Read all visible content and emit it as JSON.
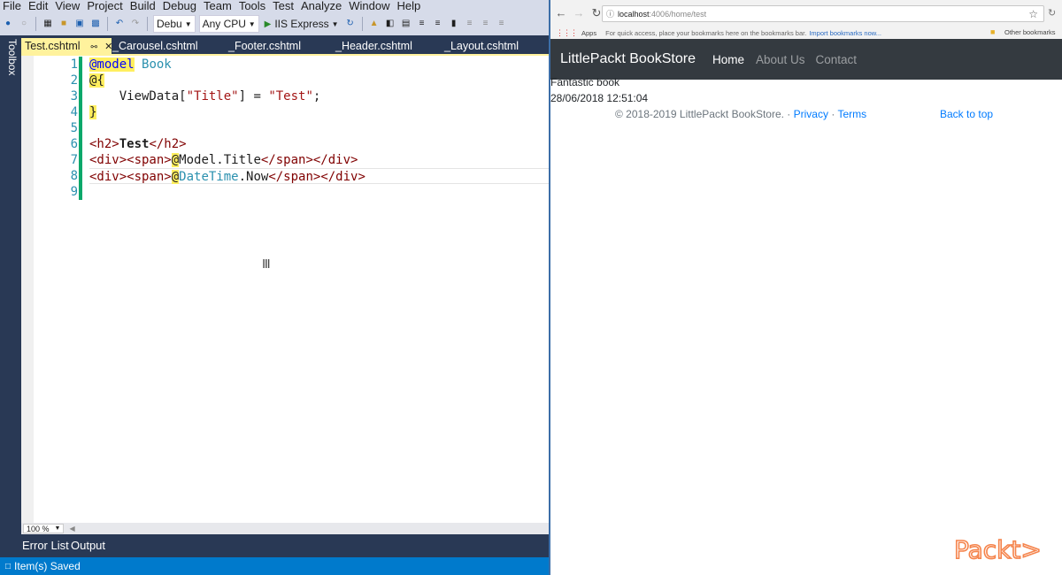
{
  "vs": {
    "menu": [
      "File",
      "Edit",
      "View",
      "Project",
      "Build",
      "Debug",
      "Team",
      "Tools",
      "Test",
      "Analyze",
      "Window",
      "Help"
    ],
    "toolbar": {
      "config": "Debu",
      "platform": "Any CPU",
      "run_target": "IIS Express"
    },
    "toolbox_label": "Toolbox",
    "tabs": [
      "Test.cshtml",
      "_Carousel.cshtml",
      "_Footer.cshtml",
      "_Header.cshtml",
      "_Layout.cshtml"
    ],
    "active_tab": "Test.cshtml",
    "line_numbers": [
      "1",
      "2",
      "3",
      "4",
      "5",
      "6",
      "7",
      "8",
      "9"
    ],
    "code": {
      "l1": {
        "directive": "@model",
        "type": "Book"
      },
      "l2": {
        "open": "@{"
      },
      "l3": {
        "ident": "ViewData",
        "lb": "[",
        "key": "\"Title\"",
        "rest": "] = ",
        "value": "\"Test\"",
        "end": ";"
      },
      "l4": {
        "close": "}"
      },
      "l6": {
        "open_tag": "<h2>",
        "text": "Test",
        "close_tag": "</h2>"
      },
      "l7": {
        "open_tags": "<div><span>",
        "at": "@",
        "expr": "Model.Title",
        "close_tags": "</span></div>"
      },
      "l8": {
        "open_tags": "<div><span>",
        "at": "@",
        "expr_type": "DateTime",
        "expr_rest": ".Now",
        "close_tags": "</span></div>"
      }
    },
    "zoom": "100 %",
    "bottom_tabs": [
      "Error List",
      "Output"
    ],
    "status": "Item(s) Saved"
  },
  "browser": {
    "url_host": "localhost",
    "url_path": ":4006/home/test",
    "bookmarks": {
      "apps": "Apps",
      "quick_access": "For quick access, place your bookmarks here on the bookmarks bar.",
      "import": "Import bookmarks now...",
      "other": "Other bookmarks"
    },
    "site": {
      "brand": "LittlePackt BookStore",
      "nav": [
        "Home",
        "About Us",
        "Contact"
      ],
      "body_lines": [
        "Fantastic book",
        "28/06/2018 12:51:04"
      ],
      "footer": {
        "copyright": "© 2018-2019 LittlePackt BookStore.",
        "separator": " · ",
        "privacy": "Privacy",
        "terms": "Terms",
        "back_to_top": "Back to top"
      }
    },
    "watermark": "Packt>"
  },
  "colors": {
    "vs_frame": "#293955",
    "vs_menu_bg": "#d6dbe9",
    "active_tab": "#fff29d",
    "status_bar": "#007acc",
    "razor_highlight": "#ffef5f",
    "navbar": "#343a40",
    "link": "#007bff",
    "packt_orange": "#f5844c"
  }
}
